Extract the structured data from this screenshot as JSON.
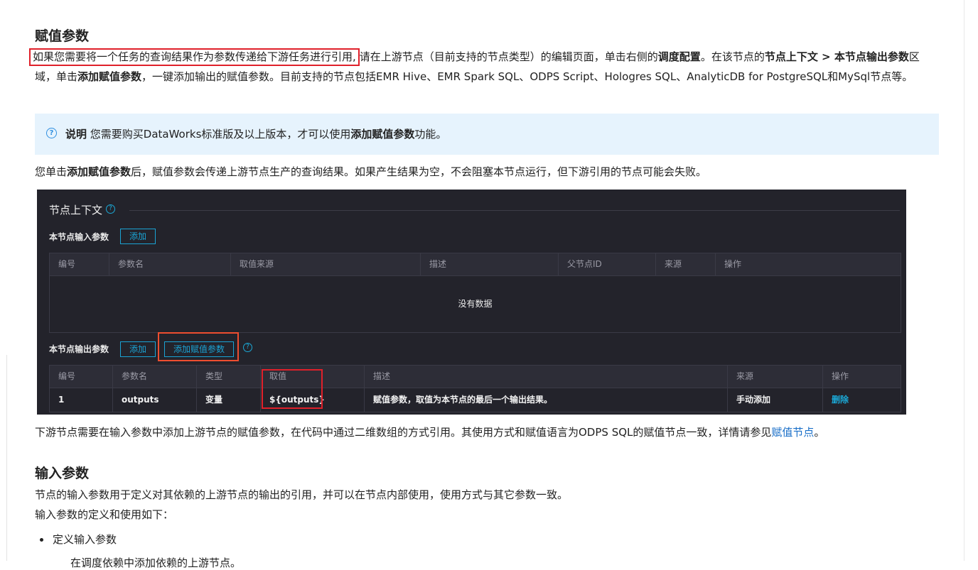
{
  "section1": {
    "title": "赋值参数",
    "p1_highlight": "如果您需要将一个任务的查询结果作为参数传递给下游任务进行引用,",
    "p1_a": "请在上游节点（目前支持的节点类型）的编辑页面，单击右侧的",
    "p1_b1": "调度配置",
    "p1_c": "。在该节点的",
    "p1_b2": "节点上下文 > 本节点输出参数",
    "p1_d": "区域，单击",
    "p1_b3": "添加赋值参数",
    "p1_e": "，一键添加输出的赋值参数。目前支持的节点包括EMR Hive、EMR Spark SQL、ODPS Script、Hologres SQL、AnalyticDB for PostgreSQL和MySql节点等。"
  },
  "note": {
    "label": "说明",
    "text_a": " 您需要购买DataWorks标准版及以上版本，才可以使用",
    "bold": "添加赋值参数",
    "text_b": "功能。"
  },
  "p2": {
    "a": "您单击",
    "bold": "添加赋值参数",
    "b": "后，赋值参数会传递上游节点生产的查询结果。如果产生结果为空，不会阻塞本节点运行，但下游引用的节点可能会失败。"
  },
  "panel": {
    "title": "节点上下文",
    "input_label": "本节点输入参数",
    "add_btn": "添加",
    "input_cols": [
      "编号",
      "参数名",
      "取值来源",
      "描述",
      "父节点ID",
      "来源",
      "操作"
    ],
    "empty_text": "没有数据",
    "output_label": "本节点输出参数",
    "add_btn2": "添加",
    "add_assign_btn": "添加赋值参数",
    "output_cols": [
      "编号",
      "参数名",
      "类型",
      "取值",
      "描述",
      "来源",
      "操作"
    ],
    "output_row": [
      "1",
      "outputs",
      "变量",
      "${outputs}",
      "赋值参数，取值为本节点的最后一个输出结果。",
      "手动添加",
      "删除"
    ]
  },
  "p3": {
    "a": "下游节点需要在输入参数中添加上游节点的赋值参数，在代码中通过二维数组的方式引用。其使用方式和赋值语言为ODPS SQL的赋值节点一致，详情请参见",
    "link": "赋值节点",
    "b": "。"
  },
  "section2": {
    "title": "输入参数",
    "p1": "节点的输入参数用于定义对其依赖的上游节点的输出的引用，并可以在节点内部使用，使用方式与其它参数一致。",
    "p2": "输入参数的定义和使用如下：",
    "bullet1": "定义输入参数",
    "cutoff": "在调度依赖中添加依赖的上游节点。"
  }
}
